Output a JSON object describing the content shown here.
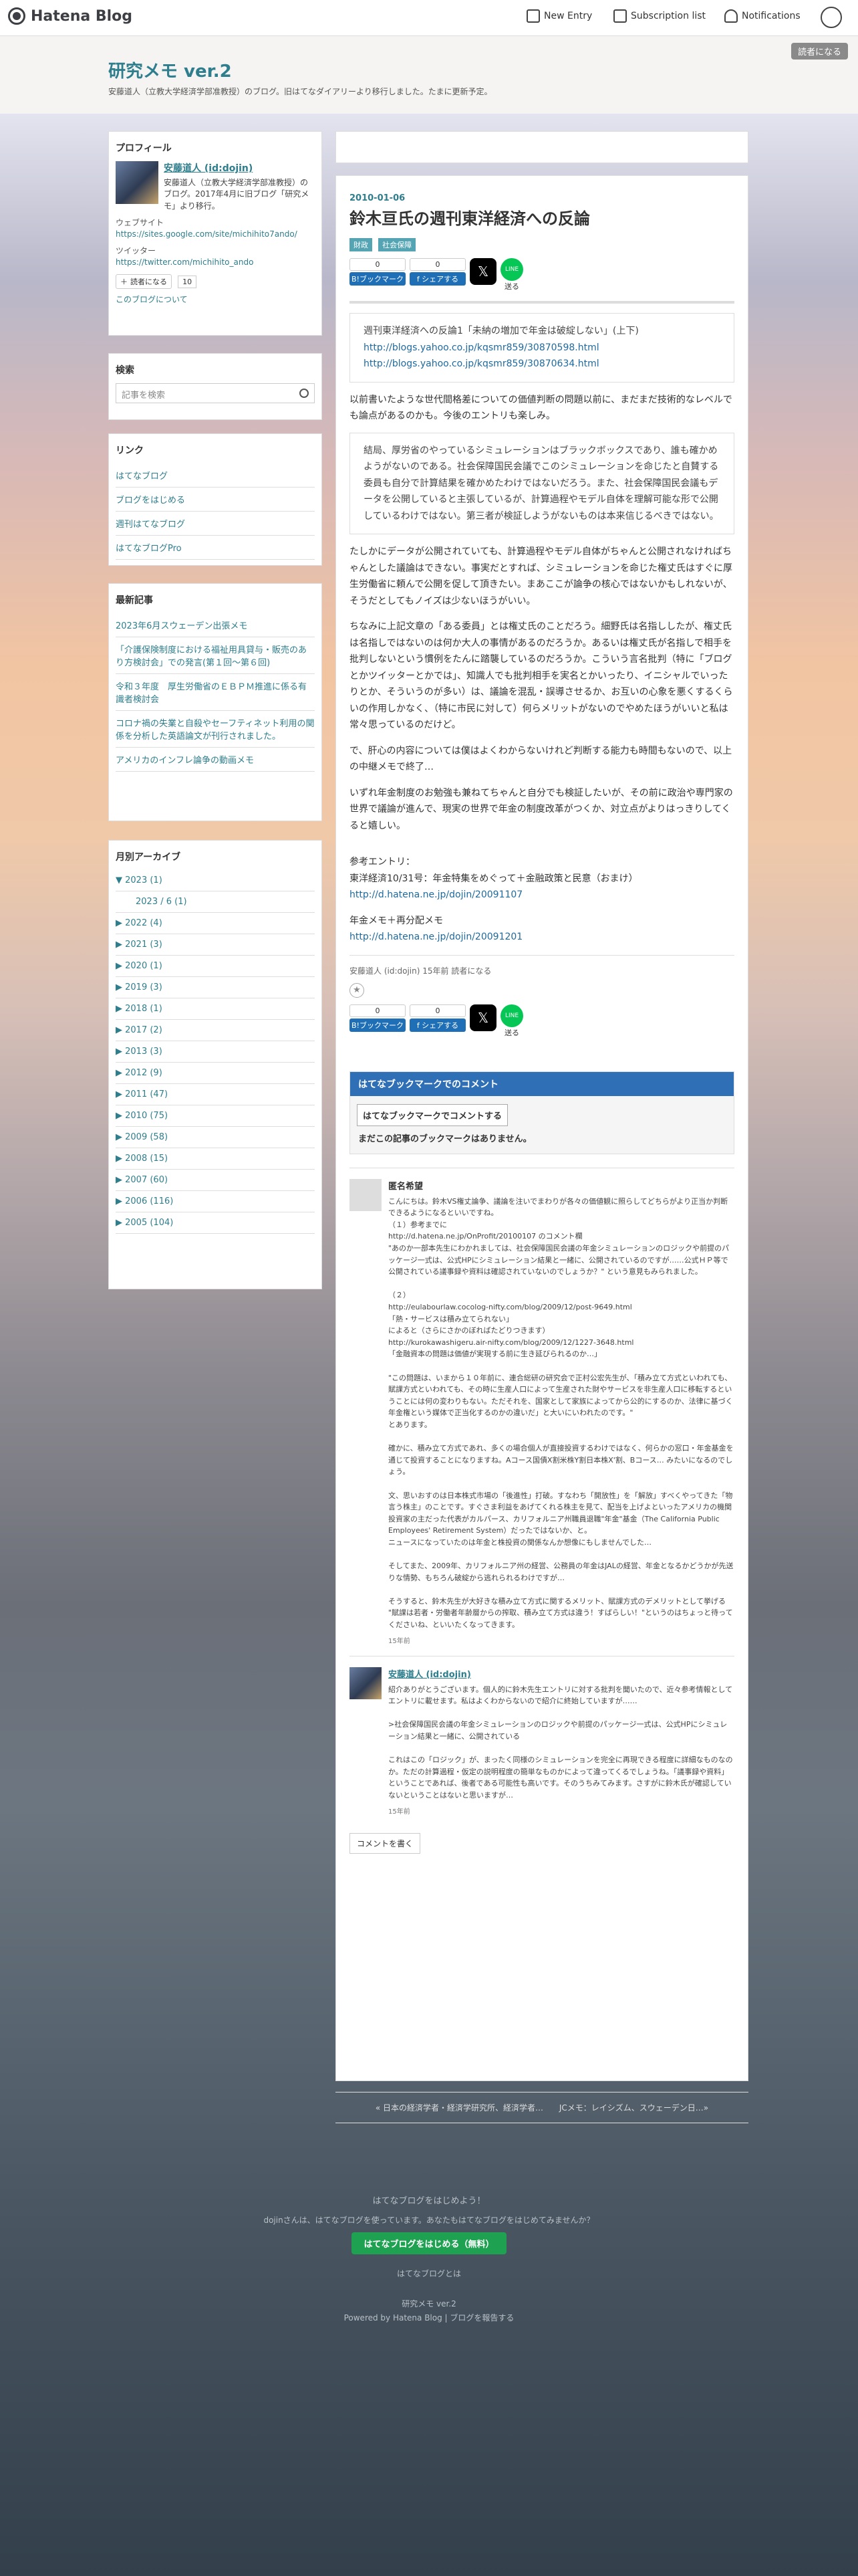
{
  "topbar": {
    "logo": "Hatena Blog",
    "new_entry": "New Entry",
    "subscription": "Subscription list",
    "notifications": "Notifications"
  },
  "header": {
    "title": "研究メモ ver.2",
    "description": "安藤道人（立教大学経済学部准教授）のブログ。旧はてなダイアリーより移行しました。たまに更新予定。",
    "reader_button": "読者になる"
  },
  "profile": {
    "heading": "プロフィール",
    "name": "安藤道人 (id:dojin)",
    "desc": "安藤道人（立教大学経済学部准教授）のブログ。2017年4月に旧ブログ「研究メモ」より移行。",
    "website_label": "ウェブサイト",
    "website": "https://sites.google.com/site/michihito7ando/",
    "twitter_label": "ツイッター",
    "twitter": "https://twitter.com/michihito_ando",
    "subscribe": "読者になる",
    "subscribe_count": "10",
    "about": "このブログについて"
  },
  "search": {
    "heading": "検索",
    "placeholder": "記事を検索"
  },
  "links": {
    "heading": "リンク",
    "items": [
      "はてなブログ",
      "ブログをはじめる",
      "週刊はてなブログ",
      "はてなブログPro"
    ]
  },
  "recent": {
    "heading": "最新記事",
    "items": [
      "2023年6月スウェーデン出張メモ",
      "「介護保険制度における福祉用具貸与・販売のあり方検討会」での発言(第１回〜第６回)",
      "令和３年度　厚生労働省のＥＢＰＭ推進に係る有識者検討会",
      "コロナ禍の失業と自殺やセーフティネット利用の関係を分析した英語論文が刊行されました。",
      "アメリカのインフレ論争の動画メモ"
    ]
  },
  "archive": {
    "heading": "月別アーカイブ",
    "items": [
      "▼ 2023 (1)",
      "2023 / 6 (1)",
      "▶ 2022 (4)",
      "▶ 2021 (3)",
      "▶ 2020 (1)",
      "▶ 2019 (3)",
      "▶ 2018 (1)",
      "▶ 2017 (2)",
      "▶ 2013 (3)",
      "▶ 2012 (9)",
      "▶ 2011 (47)",
      "▶ 2010 (75)",
      "▶ 2009 (58)",
      "▶ 2008 (15)",
      "▶ 2007 (60)",
      "▶ 2006 (116)",
      "▶ 2005 (104)"
    ]
  },
  "entry": {
    "date": "2010-01-06",
    "title": "鈴木亘氏の週刊東洋経済への反論",
    "categories": [
      "財政",
      "社会保障"
    ],
    "share": {
      "bookmark_count": "0",
      "bookmark_label": "B!ブックマーク",
      "facebook_count": "0",
      "facebook_label": "f シェアする",
      "x_label": "𝕏",
      "line_label": "送る"
    },
    "quote1_title": "週刊東洋経済への反論1「未納の増加で年金は破綻しない」(上下)",
    "quote1_link1": "http://blogs.yahoo.co.jp/kqsmr859/30870598.html",
    "quote1_link2": "http://blogs.yahoo.co.jp/kqsmr859/30870634.html",
    "para1": "以前書いたような世代間格差についての価値判断の問題以前に、まだまだ技術的なレベルでも論点があるのかも。今後のエントリも楽しみ。",
    "quote2": "結局、厚労省のやっているシミュレーションはブラックボックスであり、誰も確かめようがないのである。社会保障国民会議でこのシミュレーションを命じたと自賛する委員も自分で計算結果を確かめたわけではないだろう。また、社会保障国民会議もデータを公開していると主張しているが、計算過程やモデル自体を理解可能な形で公開しているわけではない。第三者が検証しようがないものは本来信じるべきではない。",
    "para2": "たしかにデータが公開されていても、計算過程やモデル自体がちゃんと公開されなければちゃんとした議論はできない。事実だとすれば、シミュレーションを命じた権丈氏はすぐに厚生労働省に頼んで公開を促して頂きたい。まあここが論争の核心ではないかもしれないが、そうだとしてもノイズは少ないほうがいい。",
    "para3": "ちなみに上記文章の「ある委員」とは権丈氏のことだろう。細野氏は名指ししたが、権丈氏は名指しではないのは何か大人の事情があるのだろうか。あるいは権丈氏が名指しで相手を批判しないという慣例をたんに踏襲しているのだろうか。こういう言名批判（特に「ブログとかツイッターとかでは」、知識人でも批判相手を実名とかいったり、イニシャルでいったりとか、そういうのが多い）は、議論を混乱・誤導させるか、お互いの心象を悪くするくらいの作用しかなく、（特に市民に対して）何らメリットがないのでやめたほうがいいと私は常々思っているのだけど。",
    "para4": "で、肝心の内容については僕はよくわからないけれど判断する能力も時間もないので、以上の中継メモで終了…",
    "para5": "いずれ年金制度のお勉強も兼ねてちゃんと自分でも検証したいが、その前に政治や専門家の世界で議論が進んで、現実の世界で年金の制度改革がつくか、対立点がよりはっきりしてくると嬉しい。",
    "ref_head": "参考エントリ：",
    "ref1_text": "東洋経済10/31号：年金特集をめぐって＋金融政策と民意（おまけ）",
    "ref1_link": "http://d.hatena.ne.jp/dojin/20091107",
    "ref2_text": "年金メモ＋再分配メモ",
    "ref2_link": "http://d.hatena.ne.jp/dojin/20091201",
    "meta_author": "安藤道人 (id:dojin)",
    "meta_time": "15年前",
    "meta_subscribe": "読者になる",
    "star": "★"
  },
  "bookmarks": {
    "heading": "はてなブックマークでのコメント",
    "button": "はてなブックマークでコメントする",
    "none": "まだこの記事のブックマークはありません。"
  },
  "comments": [
    {
      "name": "匿名希望",
      "body": "こんにちは。鈴木VS権丈論争、議論を注いでまわりが各々の価値観に照らしてどちらがより正当か判断できるようになるといいですね。\n（１）参考までに\nhttp://d.hatena.ne.jp/OnProfit/20100107 のコメント欄\n\"あのか一部本先生にわかれましては、社会保障国民会議の年金シミュレーションのロジックや前提のパッケージ一式は、公式HPにシミュレーション結果と一緒に、公開されているのですが……公式ＨＰ等で公開されている議事録や資料は確認されていないのでしょうか？\" という意見もみられました。\n\n（２）\nhttp://eulabourlaw.cocolog-nifty.com/blog/2009/12/post-9649.html\n「熱・サービスは積み立てられない」\nによると（さらにさかのぼればたどりつきます）\nhttp://kurokawashigeru.air-nifty.com/blog/2009/12/1227-3648.html\n「金融資本の問題は価値が実現する前に生き延びられるのか…」\n\n\"この問題は、いまから１０年前に、連合総研の研究会で正村公宏先生が、「積み立て方式といわれても、賦課方式といわれても、その時に生産人口によって生産された財やサービスを非生産人口に移転するということには何の変わりもない。ただそれを、国家として家族によってから公的にするのか、法律に基づく年金権という媒体で正当化するのかの違いだ」と大いにいわれたのです。\"\nとあります。\n\n確かに、積み立て方式であれ、多くの場合個人が直接投資するわけではなく、何らかの窓口・年金基金を通じて投資することになりますね。Aコース国債X割米株Y割日本株X'割、Bコース… みたいになるのでしょう。\n\n文、思いおすのは日本株式市場の「後進性」打破。すなわち「開放性」を「解放」すべくやってきた「物言う株主」のことです。すぐさま利益をあげてくれる株主を見て、配当を上げよといったアメリカの機関投資家の主だった代表がカルパース、カリフォルニア州職員退職\"年金\"基金（The California Public Employees' Retirement System）だったではないか、と。\nニュースになっていたのは年金と株投資の関係なんか想像にもしませんでした…\n\nそしてまた、2009年、カリフォルニア州の経営、公務員の年金はJALの経営、年金となるかどうかが先送りな情勢、もちろん破綻から逃れられるわけですが…\n\nそうすると、鈴木先生が大好きな積み立て方式に関するメリット、賦課方式のデメリットとして挙げる\n\"賦課は若者・労働者年齢層からの搾取、積み立て方式は違う！すばらしい！\"というのはちょっと待ってくださいね、といいたくなってきます。",
      "time": "15年前"
    },
    {
      "name": "安藤道人 (id:dojin)",
      "body": "紹介ありがとうございます。個人的に鈴木先生エントリに対する批判を聞いたので、近々参考情報としてエントリに載せます。私はよくわからないので紹介に終始していますが……\n\n>社会保障国民会議の年金シミュレーションのロジックや前提のパッケージ一式は、公式HPにシミュレーション結果と一緒に、公開されている\n\nこれはこの「ロジック」が、まったく同様のシミュレーションを完全に再現できる程度に詳細なものなのか。ただの計算過程・仮定の説明程度の簡単なものかによって違ってくるでしょうね。「議事録や資料」ということであれば、後者である可能性も高いです。そのうちみてみます。さすがに鈴木氏が確認していないということはないと思いますが…",
      "time": "15年前"
    }
  ],
  "write_comment": "コメントを書く",
  "pager": {
    "prev": "« 日本の経済学者・経済学研究所、経済学者…",
    "next": "JCメモ：レイシズム、スウェーデン日…»"
  },
  "footer": {
    "promo": "はてなブログをはじめよう！",
    "sub": "dojinさんは、はてなブログを使っています。あなたもはてなブログをはじめてみませんか？",
    "button": "はてなブログをはじめる（無料）",
    "about": "はてなブログとは",
    "blog_name": "研究メモ ver.2",
    "powered": "Powered by Hatena Blog | ブログを報告する"
  }
}
